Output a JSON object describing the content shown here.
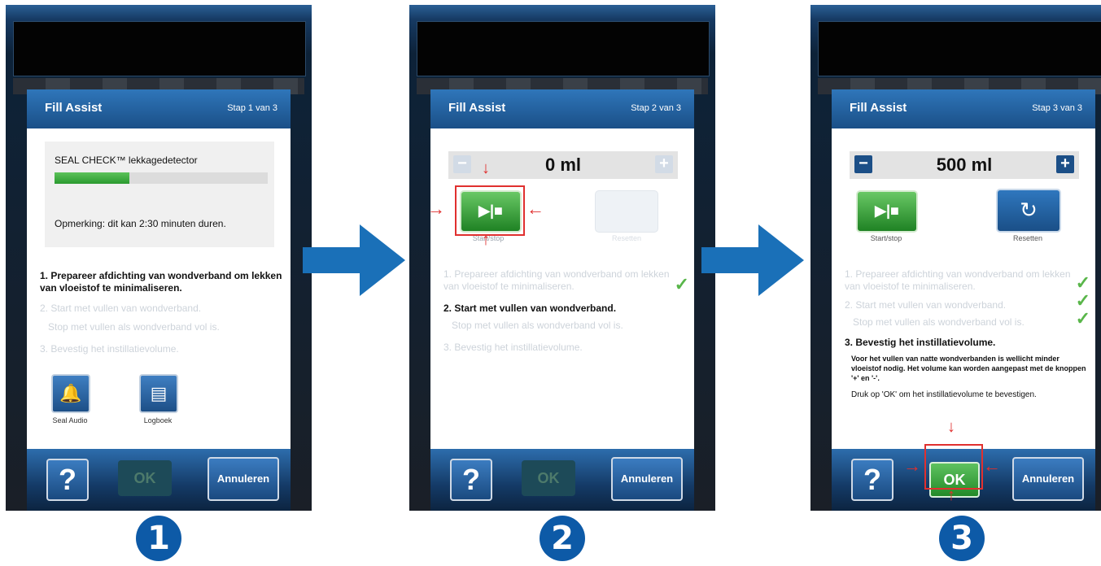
{
  "colors": {
    "accent": "#0d5aa7",
    "header": "#2f76ba",
    "green": "#3aa53f",
    "highlight": "#e0302f"
  },
  "panels": [
    {
      "number": "1",
      "title": "Fill Assist",
      "step_label": "Stap 1 van 3",
      "seal_check_label": "SEAL CHECK™ lekkagedetector",
      "seal_progress": 0.35,
      "note": "Opmerking: dit kan 2:30 minuten duren.",
      "steps": [
        {
          "text": "1. Prepareer afdichting van wondverband om lekken van vloeistof te minimaliseren.",
          "sub": "",
          "state": "active"
        },
        {
          "text": "2. Start met vullen van wondverband.",
          "sub": "Stop met vullen als wondverband vol is.",
          "state": "inactive"
        },
        {
          "text": "3. Bevestig het instillatievolume.",
          "sub": "",
          "state": "inactive"
        }
      ],
      "icons": [
        {
          "label": "Seal Audio",
          "icon": "bell-icon"
        },
        {
          "label": "Logboek",
          "icon": "log-icon"
        }
      ],
      "footer": {
        "help": "?",
        "ok": "OK",
        "cancel": "Annuleren"
      }
    },
    {
      "number": "2",
      "title": "Fill Assist",
      "step_label": "Stap 2 van 3",
      "amount": "0 ml",
      "minus": "−",
      "plus": "+",
      "play_symbol": "▶|■",
      "play_label": "Start/stop",
      "reset_label": "Resetten",
      "steps": [
        {
          "text": "1. Prepareer afdichting van wondverband om lekken van vloeistof te minimaliseren.",
          "sub": "",
          "state": "inactive",
          "done": true
        },
        {
          "text": "2. Start met vullen van wondverband.",
          "sub": "Stop met vullen als wondverband vol is.",
          "state": "active"
        },
        {
          "text": "3. Bevestig het instillatievolume.",
          "sub": "",
          "state": "inactive"
        }
      ],
      "footer": {
        "help": "?",
        "ok": "OK",
        "cancel": "Annuleren"
      }
    },
    {
      "number": "3",
      "title": "Fill Assist",
      "step_label": "Stap 3 van 3",
      "amount": "500 ml",
      "minus": "−",
      "plus": "+",
      "play_symbol": "▶|■",
      "play_label": "Start/stop",
      "reset_symbol": "↻",
      "reset_label": "Resetten",
      "steps": [
        {
          "text": "1. Prepareer afdichting van wondverband om lekken van vloeistof te minimaliseren.",
          "sub": "",
          "state": "inactive",
          "done": true
        },
        {
          "text": "2. Start met vullen van wondverband.",
          "sub": "Stop met vullen als wondverband vol is.",
          "state": "inactive",
          "done": true
        },
        {
          "text": "3. Bevestig het instillatievolume.",
          "sub": "",
          "state": "active"
        }
      ],
      "info": "Voor het vullen van natte wondverbanden is wellicht minder vloeistof nodig. Het volume kan worden aangepast met de knoppen '+' en '-'.",
      "confirm": "Druk op 'OK' om het instillatievolume te bevestigen.",
      "footer": {
        "help": "?",
        "ok": "OK",
        "cancel": "Annuleren"
      }
    }
  ],
  "flow_arrows": 2,
  "check_mark": "✓"
}
